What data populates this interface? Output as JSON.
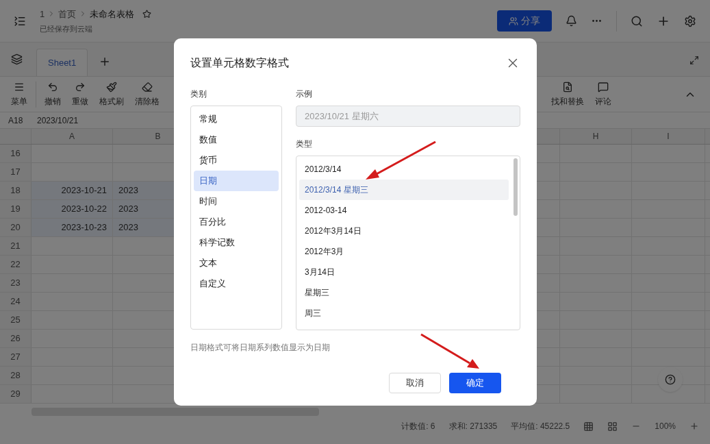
{
  "header": {
    "breadcrumb": [
      "1",
      "首页",
      "未命名表格"
    ],
    "starred": false,
    "save_status": "已经保存到云端",
    "share_button": "分享"
  },
  "sheet_tabs": [
    {
      "label": "Sheet1",
      "selected": true
    }
  ],
  "toolbar": {
    "left": [
      "菜单",
      "撤销",
      "重做",
      "格式刷",
      "清除格"
    ],
    "right": [
      "找和替换",
      "评论"
    ]
  },
  "formula_bar": {
    "cell": "A18",
    "value": "2023/10/21"
  },
  "grid": {
    "columns": [
      "A",
      "B",
      "H",
      "I"
    ],
    "rows": [
      {
        "number": "16",
        "cells": [
          "",
          ""
        ]
      },
      {
        "number": "17",
        "cells": [
          "",
          ""
        ]
      },
      {
        "number": "18",
        "cells": [
          "2023-10-21",
          "2023"
        ],
        "selected": true
      },
      {
        "number": "19",
        "cells": [
          "2023-10-22",
          "2023"
        ],
        "selected": true
      },
      {
        "number": "20",
        "cells": [
          "2023-10-23",
          "2023"
        ],
        "selected": true
      },
      {
        "number": "21",
        "cells": [
          "",
          ""
        ]
      },
      {
        "number": "22",
        "cells": [
          "",
          ""
        ]
      },
      {
        "number": "23",
        "cells": [
          "",
          ""
        ]
      },
      {
        "number": "24",
        "cells": [
          "",
          ""
        ]
      },
      {
        "number": "25",
        "cells": [
          "",
          ""
        ]
      },
      {
        "number": "26",
        "cells": [
          "",
          ""
        ]
      },
      {
        "number": "27",
        "cells": [
          "",
          ""
        ]
      },
      {
        "number": "28",
        "cells": [
          "",
          ""
        ]
      },
      {
        "number": "29",
        "cells": [
          "",
          ""
        ]
      }
    ]
  },
  "status_bar": {
    "stats": [
      "计数值: 6",
      "求和: 271335",
      "平均值: 45222.5"
    ],
    "zoom": "100%"
  },
  "dialog": {
    "title": "设置单元格数字格式",
    "category_label": "类别",
    "categories": [
      {
        "label": "常规",
        "selected": false
      },
      {
        "label": "数值",
        "selected": false
      },
      {
        "label": "货币",
        "selected": false
      },
      {
        "label": "日期",
        "selected": true
      },
      {
        "label": "时间",
        "selected": false
      },
      {
        "label": "百分比",
        "selected": false
      },
      {
        "label": "科学记数",
        "selected": false
      },
      {
        "label": "文本",
        "selected": false
      },
      {
        "label": "自定义",
        "selected": false
      }
    ],
    "example_label": "示例",
    "example_value": "2023/10/21 星期六",
    "type_label": "类型",
    "types": [
      {
        "label": "2012/3/14",
        "selected": false
      },
      {
        "label": "2012/3/14 星期三",
        "selected": true
      },
      {
        "label": "2012-03-14",
        "selected": false
      },
      {
        "label": "2012年3月14日",
        "selected": false
      },
      {
        "label": "2012年3月",
        "selected": false
      },
      {
        "label": "3月14日",
        "selected": false
      },
      {
        "label": "星期三",
        "selected": false
      },
      {
        "label": "周三",
        "selected": false
      }
    ],
    "hint": "日期格式可将日期系列数值显示为日期",
    "cancel_button": "取消",
    "ok_button": "确定"
  }
}
